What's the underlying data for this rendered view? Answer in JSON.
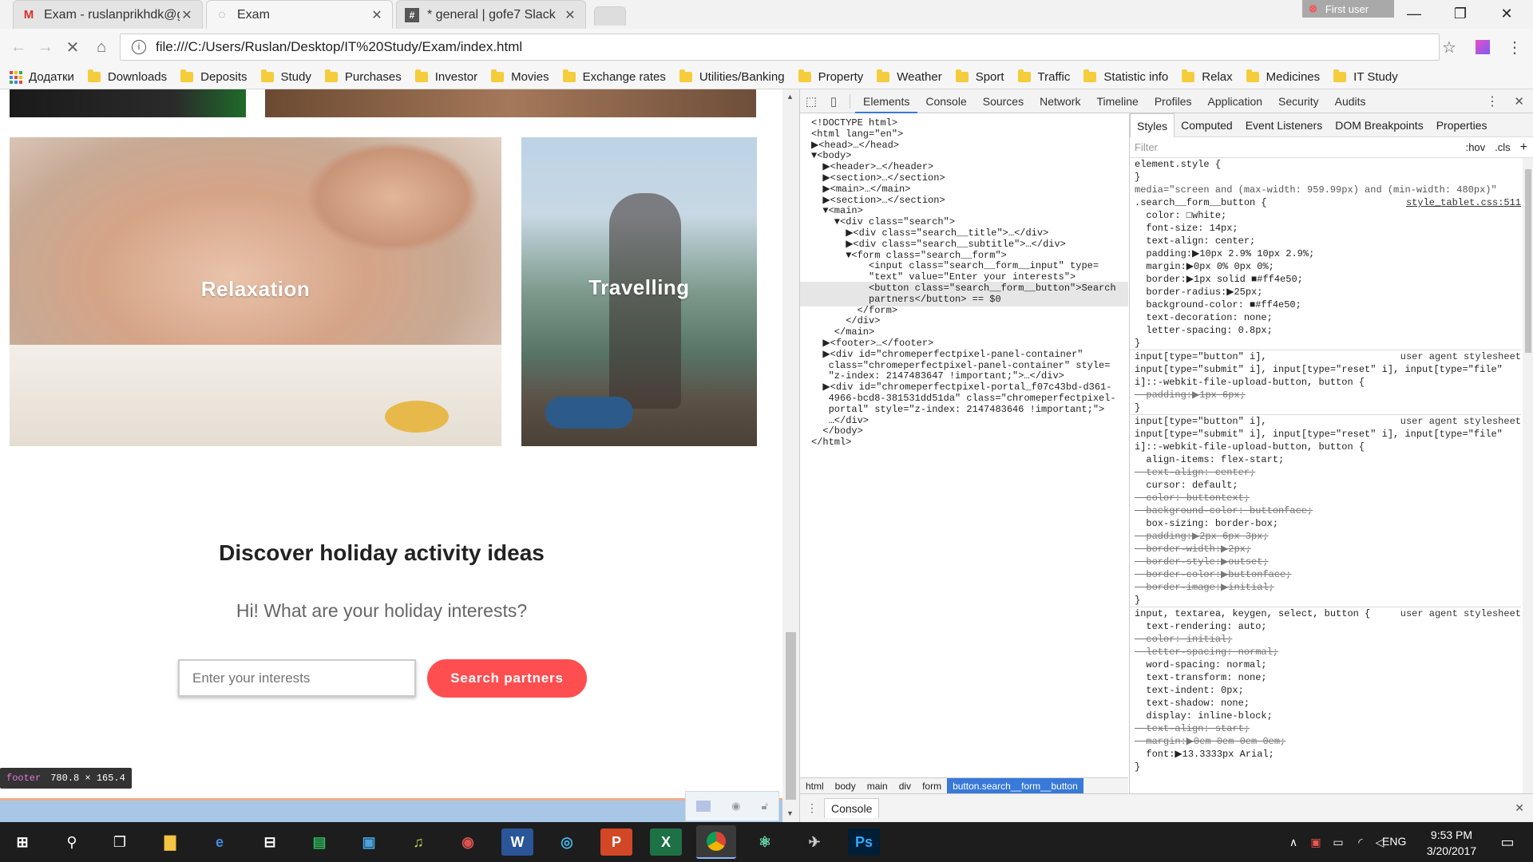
{
  "tabs": [
    {
      "title": "Exam - ruslanprikhdk@g",
      "icon": "gmail-icon",
      "active": false
    },
    {
      "title": "Exam",
      "icon": "loading-icon",
      "active": true
    },
    {
      "title": "* general | gofe7 Slack",
      "icon": "slack-icon",
      "active": false
    }
  ],
  "user_badge": "First user",
  "address": {
    "url": "file:///C:/Users/Ruslan/Desktop/IT%20Study/Exam/index.html"
  },
  "bookmarks": {
    "apps_label": "Додатки",
    "items": [
      "Downloads",
      "Deposits",
      "Study",
      "Purchases",
      "Investor",
      "Movies",
      "Exchange rates",
      "Utilities/Banking",
      "Property",
      "Weather",
      "Sport",
      "Traffic",
      "Statistic info",
      "Relax",
      "Medicines",
      "IT Study"
    ]
  },
  "page": {
    "cards": [
      {
        "label": "Relaxation"
      },
      {
        "label": "Travelling"
      }
    ],
    "search": {
      "title": "Discover holiday activity ideas",
      "subtitle": "Hi! What are your holiday interests?",
      "input_placeholder": "Enter your interests",
      "button": "Search partners"
    },
    "tooltip": {
      "tag": "footer",
      "size": "780.8 × 165.4"
    }
  },
  "devtools": {
    "tabs": [
      "Elements",
      "Console",
      "Sources",
      "Network",
      "Timeline",
      "Profiles",
      "Application",
      "Security",
      "Audits"
    ],
    "active_tab": "Elements",
    "dom_lines": [
      "<!DOCTYPE html>",
      "<html lang=\"en\">",
      "▶<head>…</head>",
      "▼<body>",
      "  ▶<header>…</header>",
      "  ▶<section>…</section>",
      "  ▶<main>…</main>",
      "  ▶<section>…</section>",
      "  ▼<main>",
      "    ▼<div class=\"search\">",
      "      ▶<div class=\"search__title\">…</div>",
      "      ▶<div class=\"search__subtitle\">…</div>",
      "      ▼<form class=\"search__form\">",
      "          <input class=\"search__form__input\" type=",
      "          \"text\" value=\"Enter your interests\">",
      "          <button class=\"search__form__button\">Search",
      "          partners</button> == $0",
      "        </form>",
      "      </div>",
      "    </main>",
      "  ▶<footer>…</footer>",
      "  ▶<div id=\"chromeperfectpixel-panel-container\"",
      "   class=\"chromeperfectpixel-panel-container\" style=",
      "   \"z-index: 2147483647 !important;\">…</div>",
      "  ▶<div id=\"chromeperfectpixel-portal_f07c43bd-d361-",
      "   4966-bcd8-381531dd51da\" class=\"chromeperfectpixel-",
      "   portal\" style=\"z-index: 2147483646 !important;\">",
      "   …</div>",
      "  </body>",
      "</html>"
    ],
    "breadcrumbs": [
      "html",
      "body",
      "main",
      "div",
      "form",
      "button.search__form__button"
    ],
    "styles_tabs": [
      "Styles",
      "Computed",
      "Event Listeners",
      "DOM Breakpoints",
      "Properties"
    ],
    "filter_placeholder": "Filter",
    "filter_hov": ":hov",
    "filter_cls": ".cls",
    "rules": [
      {
        "text": "element.style {",
        "cls": ""
      },
      {
        "text": "}",
        "cls": ""
      },
      {
        "text": "media=\"screen and (max-width: 959.99px) and (min-width: 480px)\"",
        "cls": ""
      },
      {
        "text": ".search__form__button {",
        "cls": "",
        "src": "style_tablet.css:511"
      },
      {
        "text": "  color: □white;",
        "cls": "p"
      },
      {
        "text": "  font-size: 14px;",
        "cls": "p"
      },
      {
        "text": "  text-align: center;",
        "cls": "p"
      },
      {
        "text": "  padding:▶10px 2.9% 10px 2.9%;",
        "cls": "p"
      },
      {
        "text": "  margin:▶0px 0% 0px 0%;",
        "cls": "p"
      },
      {
        "text": "  border:▶1px solid ■#ff4e50;",
        "cls": "p"
      },
      {
        "text": "  border-radius:▶25px;",
        "cls": "p"
      },
      {
        "text": "  background-color: ■#ff4e50;",
        "cls": "p"
      },
      {
        "text": "  text-decoration: none;",
        "cls": "p"
      },
      {
        "text": "  letter-spacing: 0.8px;",
        "cls": "p"
      },
      {
        "text": "}",
        "cls": ""
      },
      {
        "text": "input[type=\"button\" i],",
        "cls": "",
        "src": "user agent stylesheet"
      },
      {
        "text": "input[type=\"submit\" i], input[type=\"reset\" i], input[type=\"file\"",
        "cls": ""
      },
      {
        "text": "i]::-webkit-file-upload-button, button {",
        "cls": ""
      },
      {
        "text": "  padding:▶1px 6px;",
        "cls": "s"
      },
      {
        "text": "}",
        "cls": ""
      },
      {
        "text": "input[type=\"button\" i],",
        "cls": "",
        "src": "user agent stylesheet"
      },
      {
        "text": "input[type=\"submit\" i], input[type=\"reset\" i], input[type=\"file\"",
        "cls": ""
      },
      {
        "text": "i]::-webkit-file-upload-button, button {",
        "cls": ""
      },
      {
        "text": "  align-items: flex-start;",
        "cls": "p"
      },
      {
        "text": "  text-align: center;",
        "cls": "s"
      },
      {
        "text": "  cursor: default;",
        "cls": "p"
      },
      {
        "text": "  color: buttontext;",
        "cls": "s"
      },
      {
        "text": "  background-color: buttonface;",
        "cls": "s"
      },
      {
        "text": "  box-sizing: border-box;",
        "cls": "p"
      },
      {
        "text": "  padding:▶2px 6px 3px;",
        "cls": "s"
      },
      {
        "text": "  border-width:▶2px;",
        "cls": "s"
      },
      {
        "text": "  border-style:▶outset;",
        "cls": "s"
      },
      {
        "text": "  border-color:▶buttonface;",
        "cls": "s"
      },
      {
        "text": "  border-image:▶initial;",
        "cls": "s"
      },
      {
        "text": "}",
        "cls": ""
      },
      {
        "text": "input, textarea, keygen, select, button {",
        "cls": "",
        "src": "user agent stylesheet"
      },
      {
        "text": "  text-rendering: auto;",
        "cls": "p"
      },
      {
        "text": "  color: initial;",
        "cls": "s"
      },
      {
        "text": "  letter-spacing: normal;",
        "cls": "s"
      },
      {
        "text": "  word-spacing: normal;",
        "cls": "p"
      },
      {
        "text": "  text-transform: none;",
        "cls": "p"
      },
      {
        "text": "  text-indent: 0px;",
        "cls": "p"
      },
      {
        "text": "  text-shadow: none;",
        "cls": "p"
      },
      {
        "text": "  display: inline-block;",
        "cls": "p"
      },
      {
        "text": "  text-align: start;",
        "cls": "s"
      },
      {
        "text": "  margin:▶0em 0em 0em 0em;",
        "cls": "s"
      },
      {
        "text": "  font:▶13.3333px Arial;",
        "cls": "p"
      },
      {
        "text": "}",
        "cls": ""
      }
    ],
    "console_label": "Console"
  },
  "taskbar": {
    "lang": "ENG",
    "time": "9:53 PM",
    "date": "3/20/2017"
  },
  "colors": {
    "accent": "#ff4e50",
    "devtools_blue": "#3879d9"
  }
}
